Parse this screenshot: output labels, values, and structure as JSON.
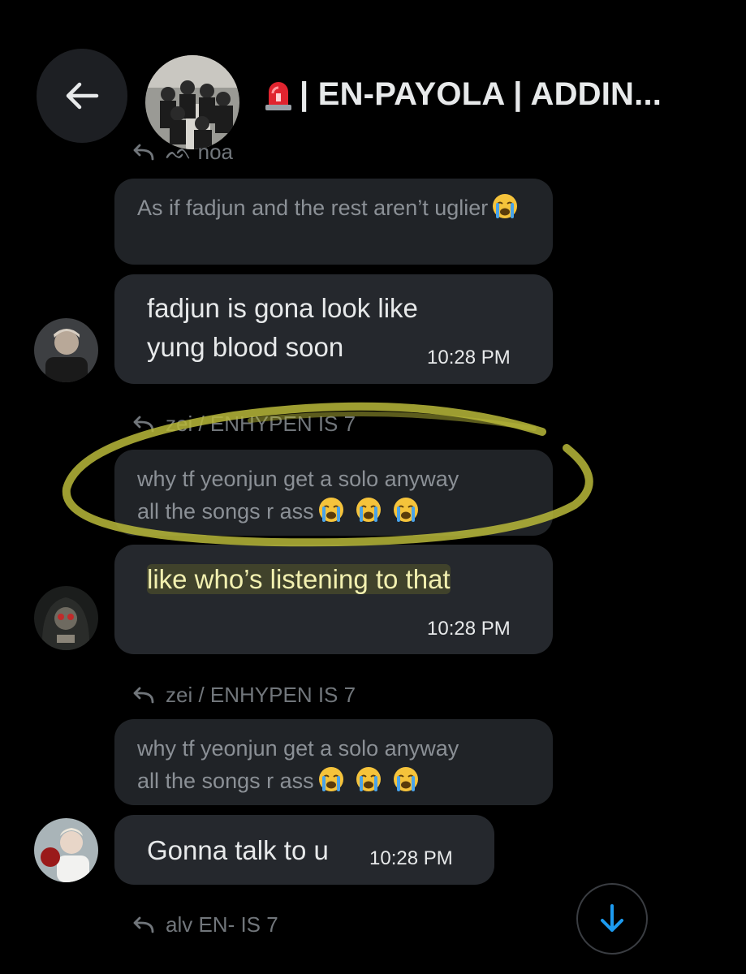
{
  "header": {
    "title": "| EN-PAYOLA | ADDIN...",
    "back_icon": "arrow-left-icon",
    "siren_icon": "siren-emoji-icon"
  },
  "messages": [
    {
      "reply_to": "ᨒ noa",
      "quoted": "As if fadjun and the rest aren’t uglier",
      "text_line1": "fadjun is gona look like",
      "text_line2": "yung blood soon",
      "time": "10:28 PM"
    },
    {
      "reply_to": "zei / ENHYPEN IS 7",
      "quoted_line1": "why tf yeonjun get a solo anyway",
      "quoted_line2": "all the songs r ass",
      "text": "like who’s listening to that",
      "time": "10:28 PM"
    },
    {
      "reply_to": "zei / ENHYPEN IS 7",
      "quoted_line1": "why tf yeonjun get a solo anyway",
      "quoted_line2": "all the songs r ass",
      "text": "Gonna talk to u",
      "time": "10:28 PM"
    }
  ],
  "next_reply_to": "alv EN- IS 7",
  "scroll_icon": "arrow-down-icon",
  "colors": {
    "background": "#000000",
    "bubble": "#25282d",
    "quote_bubble": "#202327",
    "muted_text": "#71767b",
    "accent_blue": "#1d9bf0",
    "highlight_yellow": "#b8b83a"
  }
}
